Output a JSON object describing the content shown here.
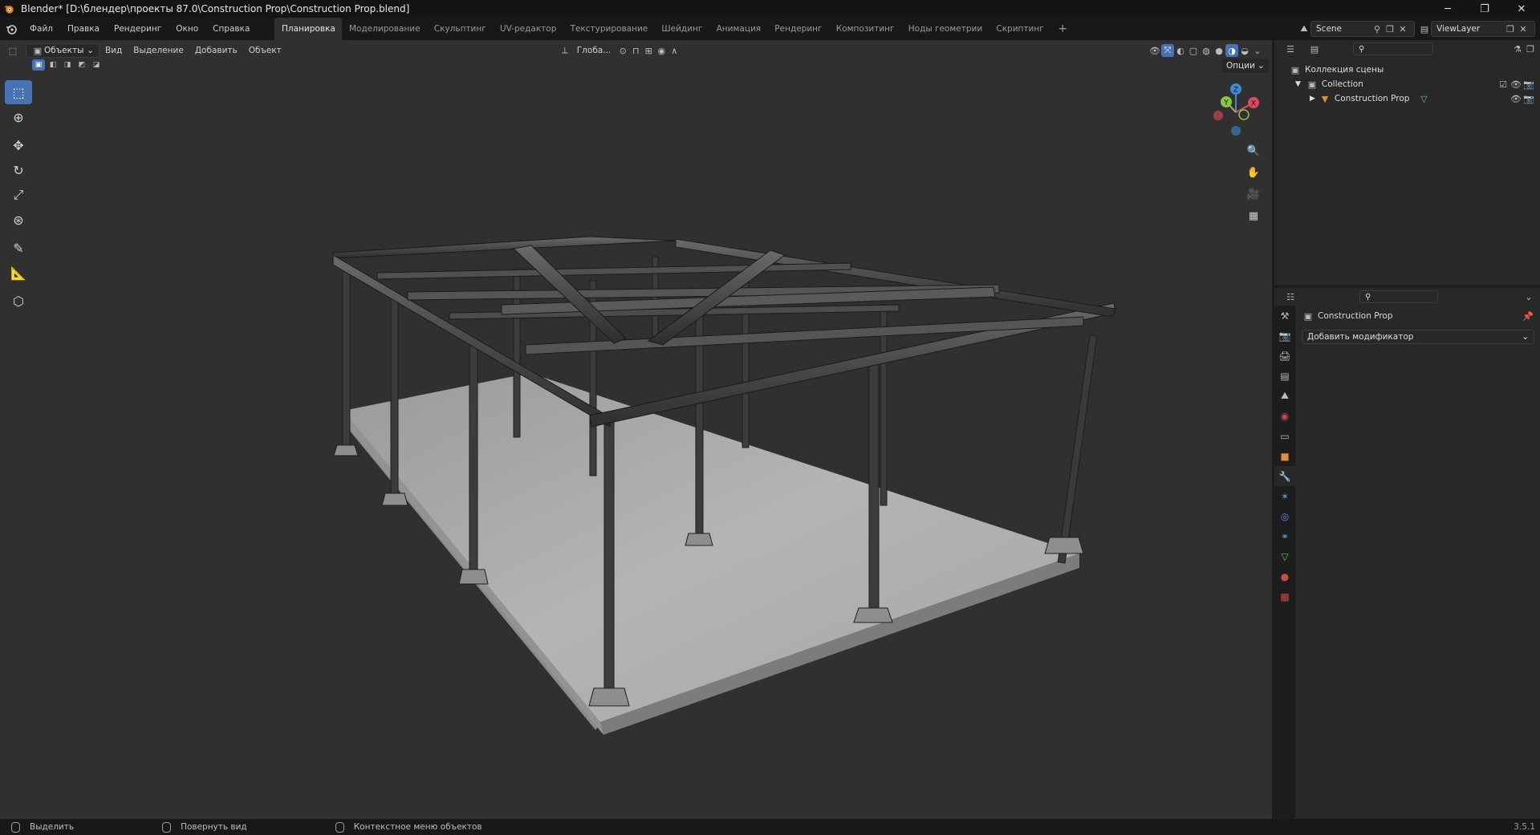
{
  "window": {
    "title": "Blender* [D:\\блендер\\проекты 87.0\\Construction Prop\\Construction Prop.blend]",
    "minimize": "─",
    "restore": "❐",
    "close": "✕"
  },
  "menu": [
    "Файл",
    "Правка",
    "Рендеринг",
    "Окно",
    "Справка"
  ],
  "workspaces": [
    "Планировка",
    "Моделирование",
    "Скульптинг",
    "UV-редактор",
    "Текстурирование",
    "Шейдинг",
    "Анимация",
    "Рендеринг",
    "Композитинг",
    "Ноды геометрии",
    "Скриптинг"
  ],
  "active_workspace": "Планировка",
  "scene": {
    "name": "Scene",
    "view_layer": "ViewLayer"
  },
  "viewport_header": {
    "mode": "Объекты",
    "menus": [
      "Вид",
      "Выделение",
      "Добавить",
      "Объект"
    ],
    "orientation": "Глоба...",
    "options_label": "Опции"
  },
  "gizmo": {
    "x": "X",
    "y": "Y",
    "z": "Z"
  },
  "outliner": {
    "root": "Коллекция сцены",
    "collection": "Collection",
    "object": "Construction Prop"
  },
  "properties": {
    "object_name": "Construction Prop",
    "add_modifier": "Добавить модификатор"
  },
  "statusbar": {
    "items": [
      "Выделить",
      "Повернуть вид",
      "Контекстное меню объектов"
    ],
    "version": "3.5.1"
  },
  "colors": {
    "accent": "#4772b3",
    "axis_x": "#e04a5f",
    "axis_y": "#8cc63f",
    "axis_z": "#3d8bd6",
    "mesh_icon": "#5ec26c",
    "object_icon": "#e08a3c"
  },
  "icons": {
    "tools": [
      "select-box-icon",
      "cursor-icon",
      "move-icon",
      "rotate-icon",
      "scale-icon",
      "transform-icon",
      "annotate-icon",
      "measure-icon",
      "add-cube-icon"
    ],
    "nav": [
      "zoom-icon",
      "hand-icon",
      "camera-icon",
      "grid-icon"
    ],
    "property_tabs": [
      "tool-icon",
      "render-icon",
      "output-icon",
      "view-layer-icon",
      "scene-icon",
      "world-icon",
      "collection-icon",
      "object-icon",
      "modifier-icon",
      "particles-icon",
      "physics-icon",
      "constraints-icon",
      "data-icon",
      "material-icon",
      "texture-icon"
    ]
  }
}
